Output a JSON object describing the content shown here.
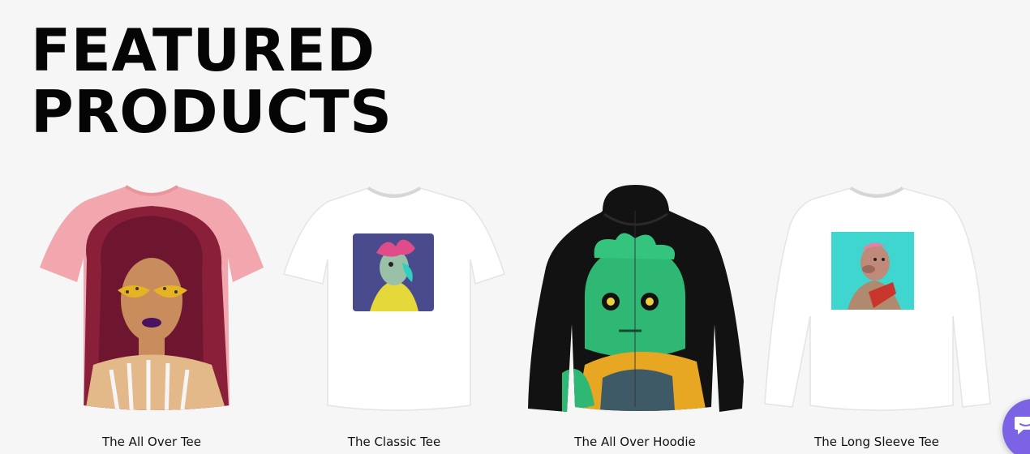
{
  "section": {
    "heading_line1": "FEATURED",
    "heading_line2": "PRODUCTS"
  },
  "products": [
    {
      "name": "The All Over Tee",
      "icon": "pink-tee-with-woman-art"
    },
    {
      "name": "The Classic Tee",
      "icon": "white-tee-with-nft-art"
    },
    {
      "name": "The All Over Hoodie",
      "icon": "black-hoodie-with-green-zombie-art"
    },
    {
      "name": "The Long Sleeve Tee",
      "icon": "white-long-sleeve-with-ape-art"
    }
  ],
  "chat": {
    "icon": "chat-icon",
    "color": "#7c63e6"
  }
}
